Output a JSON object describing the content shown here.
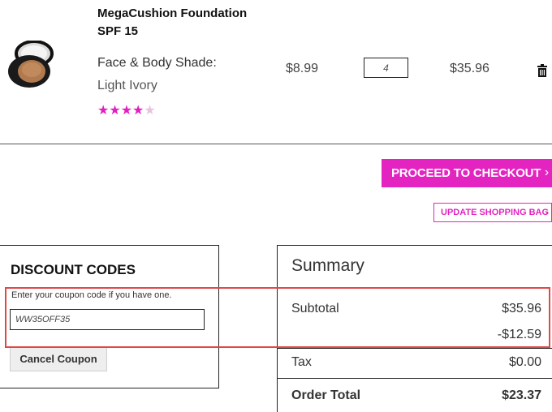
{
  "product": {
    "name": "MegaCushion Foundation SPF 15",
    "shade_label": "Face & Body Shade:",
    "shade_value": "Light Ivory",
    "rating_stars": "★★★★",
    "rating_partial": "★",
    "rating": 4.5,
    "price": "$8.99",
    "quantity": "4",
    "line_total": "$35.96",
    "icon": "trash-icon"
  },
  "actions": {
    "checkout_label": "PROCEED TO CHECKOUT",
    "checkout_chevron": "›",
    "update_label": "UPDATE SHOPPING BAG",
    "update_chevron": "›"
  },
  "discount": {
    "title": "DISCOUNT CODES",
    "help_text": "Enter your coupon code if you have one.",
    "coupon_value": "WW35OFF35",
    "cancel_label": "Cancel Coupon"
  },
  "summary": {
    "title": "Summary",
    "subtotal_label": "Subtotal",
    "subtotal_value": "$35.96",
    "discount_value": "-$12.59",
    "tax_label": "Tax",
    "tax_value": "$0.00",
    "order_total_label": "Order Total",
    "order_total_value": "$23.37"
  },
  "colors": {
    "accent": "#e324c0",
    "highlight": "#e04848"
  }
}
